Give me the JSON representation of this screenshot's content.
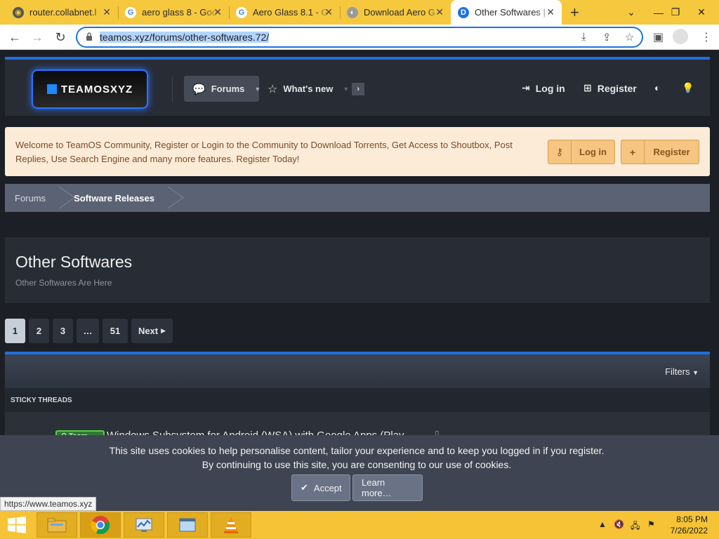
{
  "browser": {
    "tabs": [
      {
        "title": "router.collabnet.l",
        "favicon": "router-icon",
        "active": false
      },
      {
        "title": "aero glass 8 - Goo",
        "favicon": "google-icon",
        "active": false
      },
      {
        "title": "Aero Glass 8.1 - G",
        "favicon": "google-icon",
        "active": false
      },
      {
        "title": "Download Aero G",
        "favicon": "site-icon",
        "active": false
      },
      {
        "title": "Other Softwares |",
        "favicon": "teamos-icon",
        "active": true
      }
    ],
    "url": "teamos.xyz/forums/other-softwares.72/",
    "status_url": "https://www.teamos.xyz"
  },
  "site": {
    "logo_text": "TEAMOSXYZ",
    "nav": {
      "forums": "Forums",
      "whats_new": "What's new",
      "login": "Log in",
      "register": "Register"
    },
    "welcome": {
      "text": "Welcome to TeamOS Community, Register or Login to the Community to Download Torrents, Get Access to Shoutbox, Post Replies, Use Search Engine and many more features. Register Today!",
      "login": "Log in",
      "register": "Register"
    },
    "breadcrumbs": [
      "Forums",
      "Software Releases"
    ],
    "forum": {
      "title": "Other Softwares",
      "subtitle": "Other Softwares Are Here"
    },
    "pagination": {
      "pages": [
        "1",
        "2",
        "3",
        "…",
        "51"
      ],
      "current": "1",
      "next": "Next"
    },
    "threads": {
      "filters": "Filters",
      "sticky_header": "STICKY THREADS",
      "first_thread_title": "Windows Subsystem for Android (WSA) with Google Apps (Play",
      "first_thread_prefix": "Team"
    },
    "cookie": {
      "line1": "This site uses cookies to help personalise content, tailor your experience and to keep you logged in if you register.",
      "line2": "By continuing to use this site, you are consenting to our use of cookies.",
      "accept": "Accept",
      "learn_more": "Learn more…"
    }
  },
  "taskbar": {
    "time": "8:05 PM",
    "date": "7/26/2022",
    "accent": "#f5c335"
  },
  "colors": {
    "link_blue": "#1f6fe0",
    "page_bg": "#1c1f26",
    "welcome_bg": "#fcebd6",
    "welcome_btn": "#f5c581"
  }
}
